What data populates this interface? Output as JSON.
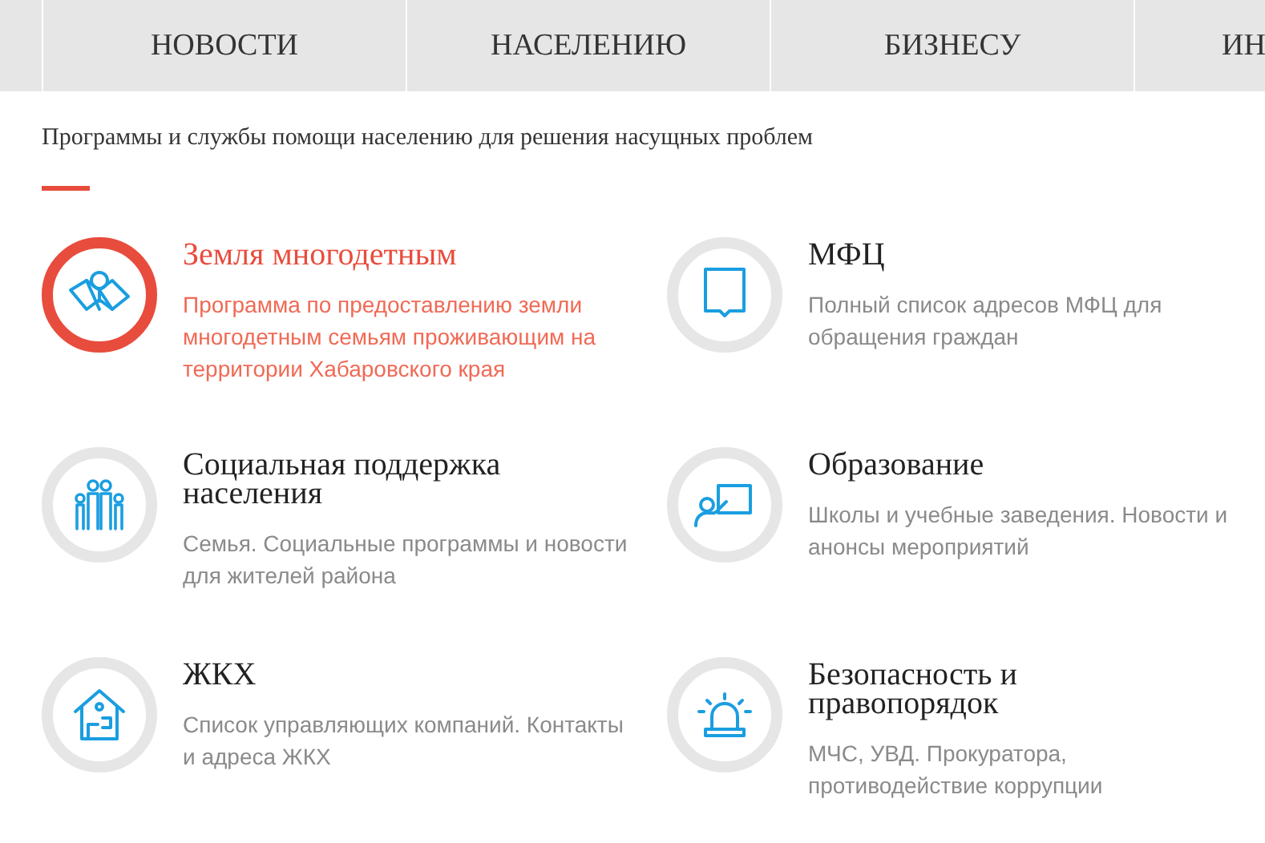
{
  "nav": {
    "items": [
      {
        "label": "НОВОСТИ"
      },
      {
        "label": "НАСЕЛЕНИЮ"
      },
      {
        "label": "БИЗНЕСУ"
      },
      {
        "label": "ИН"
      }
    ]
  },
  "section": {
    "subtitle": "Программы и службы помощи населению для решения насущных проблем"
  },
  "services": [
    {
      "title": "Земля многодетным",
      "description": "Программа по предоставлению земли многодетным семьям проживающим на территории Хабаровского края",
      "active": true
    },
    {
      "title": "МФЦ",
      "description": "Полный список адресов МФЦ для обращения граждан",
      "active": false
    },
    {
      "title": "Социальная поддержка населения",
      "description": "Семья. Социальные программы и новости для жителей района",
      "active": false
    },
    {
      "title": "Образование",
      "description": "Школы и учебные заведения. Новости и анонсы мероприятий",
      "active": false
    },
    {
      "title": "ЖКХ",
      "description": "Список управляющих компаний. Контакты и адреса ЖКХ",
      "active": false
    },
    {
      "title": "Безопасность и правопорядок",
      "description": "МЧС, УВД. Прокуратора, противодействие коррупции",
      "active": false
    }
  ]
}
